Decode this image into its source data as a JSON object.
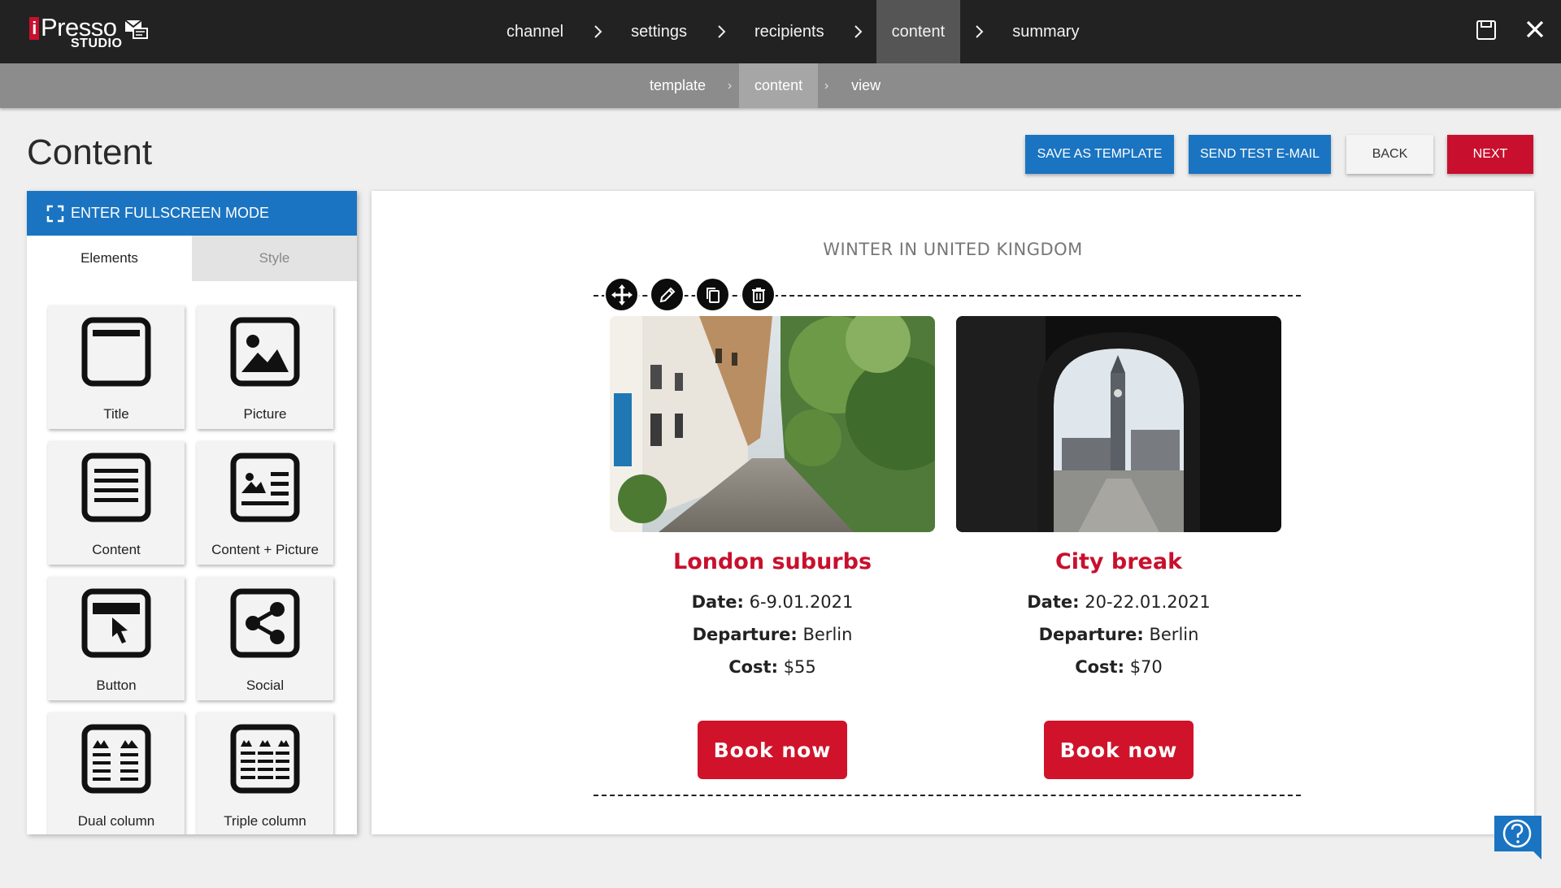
{
  "app": {
    "brand": "Presso",
    "brand_sub": "STUDIO"
  },
  "steps": [
    {
      "label": "channel"
    },
    {
      "label": "settings"
    },
    {
      "label": "recipients"
    },
    {
      "label": "content"
    },
    {
      "label": "summary"
    }
  ],
  "active_step": "content",
  "substeps": [
    {
      "label": "template"
    },
    {
      "label": "content"
    },
    {
      "label": "view"
    }
  ],
  "active_substep": "content",
  "page": {
    "title": "Content"
  },
  "actions": {
    "save_template": "SAVE AS TEMPLATE",
    "send_test": "SEND TEST E-MAIL",
    "back": "BACK",
    "next": "NEXT"
  },
  "panel": {
    "fullscreen": "ENTER FULLSCREEN MODE",
    "tabs": [
      {
        "label": "Elements"
      },
      {
        "label": "Style"
      }
    ],
    "active_tab": "Elements",
    "elements": [
      {
        "label": "Title",
        "icon": "title-block-icon"
      },
      {
        "label": "Picture",
        "icon": "picture-block-icon"
      },
      {
        "label": "Content",
        "icon": "content-block-icon"
      },
      {
        "label": "Content + Picture",
        "icon": "content-picture-block-icon"
      },
      {
        "label": "Button",
        "icon": "button-block-icon"
      },
      {
        "label": "Social",
        "icon": "social-share-icon"
      },
      {
        "label": "Dual column",
        "icon": "dual-column-icon"
      },
      {
        "label": "Triple column",
        "icon": "triple-column-icon"
      }
    ]
  },
  "email": {
    "heading": "WINTER IN UNITED KINGDOM",
    "block_tools": [
      "move-icon",
      "edit-pencil-icon",
      "duplicate-icon",
      "delete-trash-icon"
    ],
    "cards": [
      {
        "title": "London suburbs",
        "date_label": "Date:",
        "date": "6-9.01.2021",
        "departure_label": "Departure:",
        "departure": "Berlin",
        "cost_label": "Cost:",
        "cost": "$55",
        "button": "Book now",
        "image": "london-street-photo"
      },
      {
        "title": "City break",
        "date_label": "Date:",
        "date": "20-22.01.2021",
        "departure_label": "Departure:",
        "departure": "Berlin",
        "cost_label": "Cost:",
        "cost": "$70",
        "button": "Book now",
        "image": "big-ben-archway-photo"
      }
    ]
  },
  "colors": {
    "topbar": "#222222",
    "accent_blue": "#1a74c1",
    "accent_red": "#c8102e"
  }
}
